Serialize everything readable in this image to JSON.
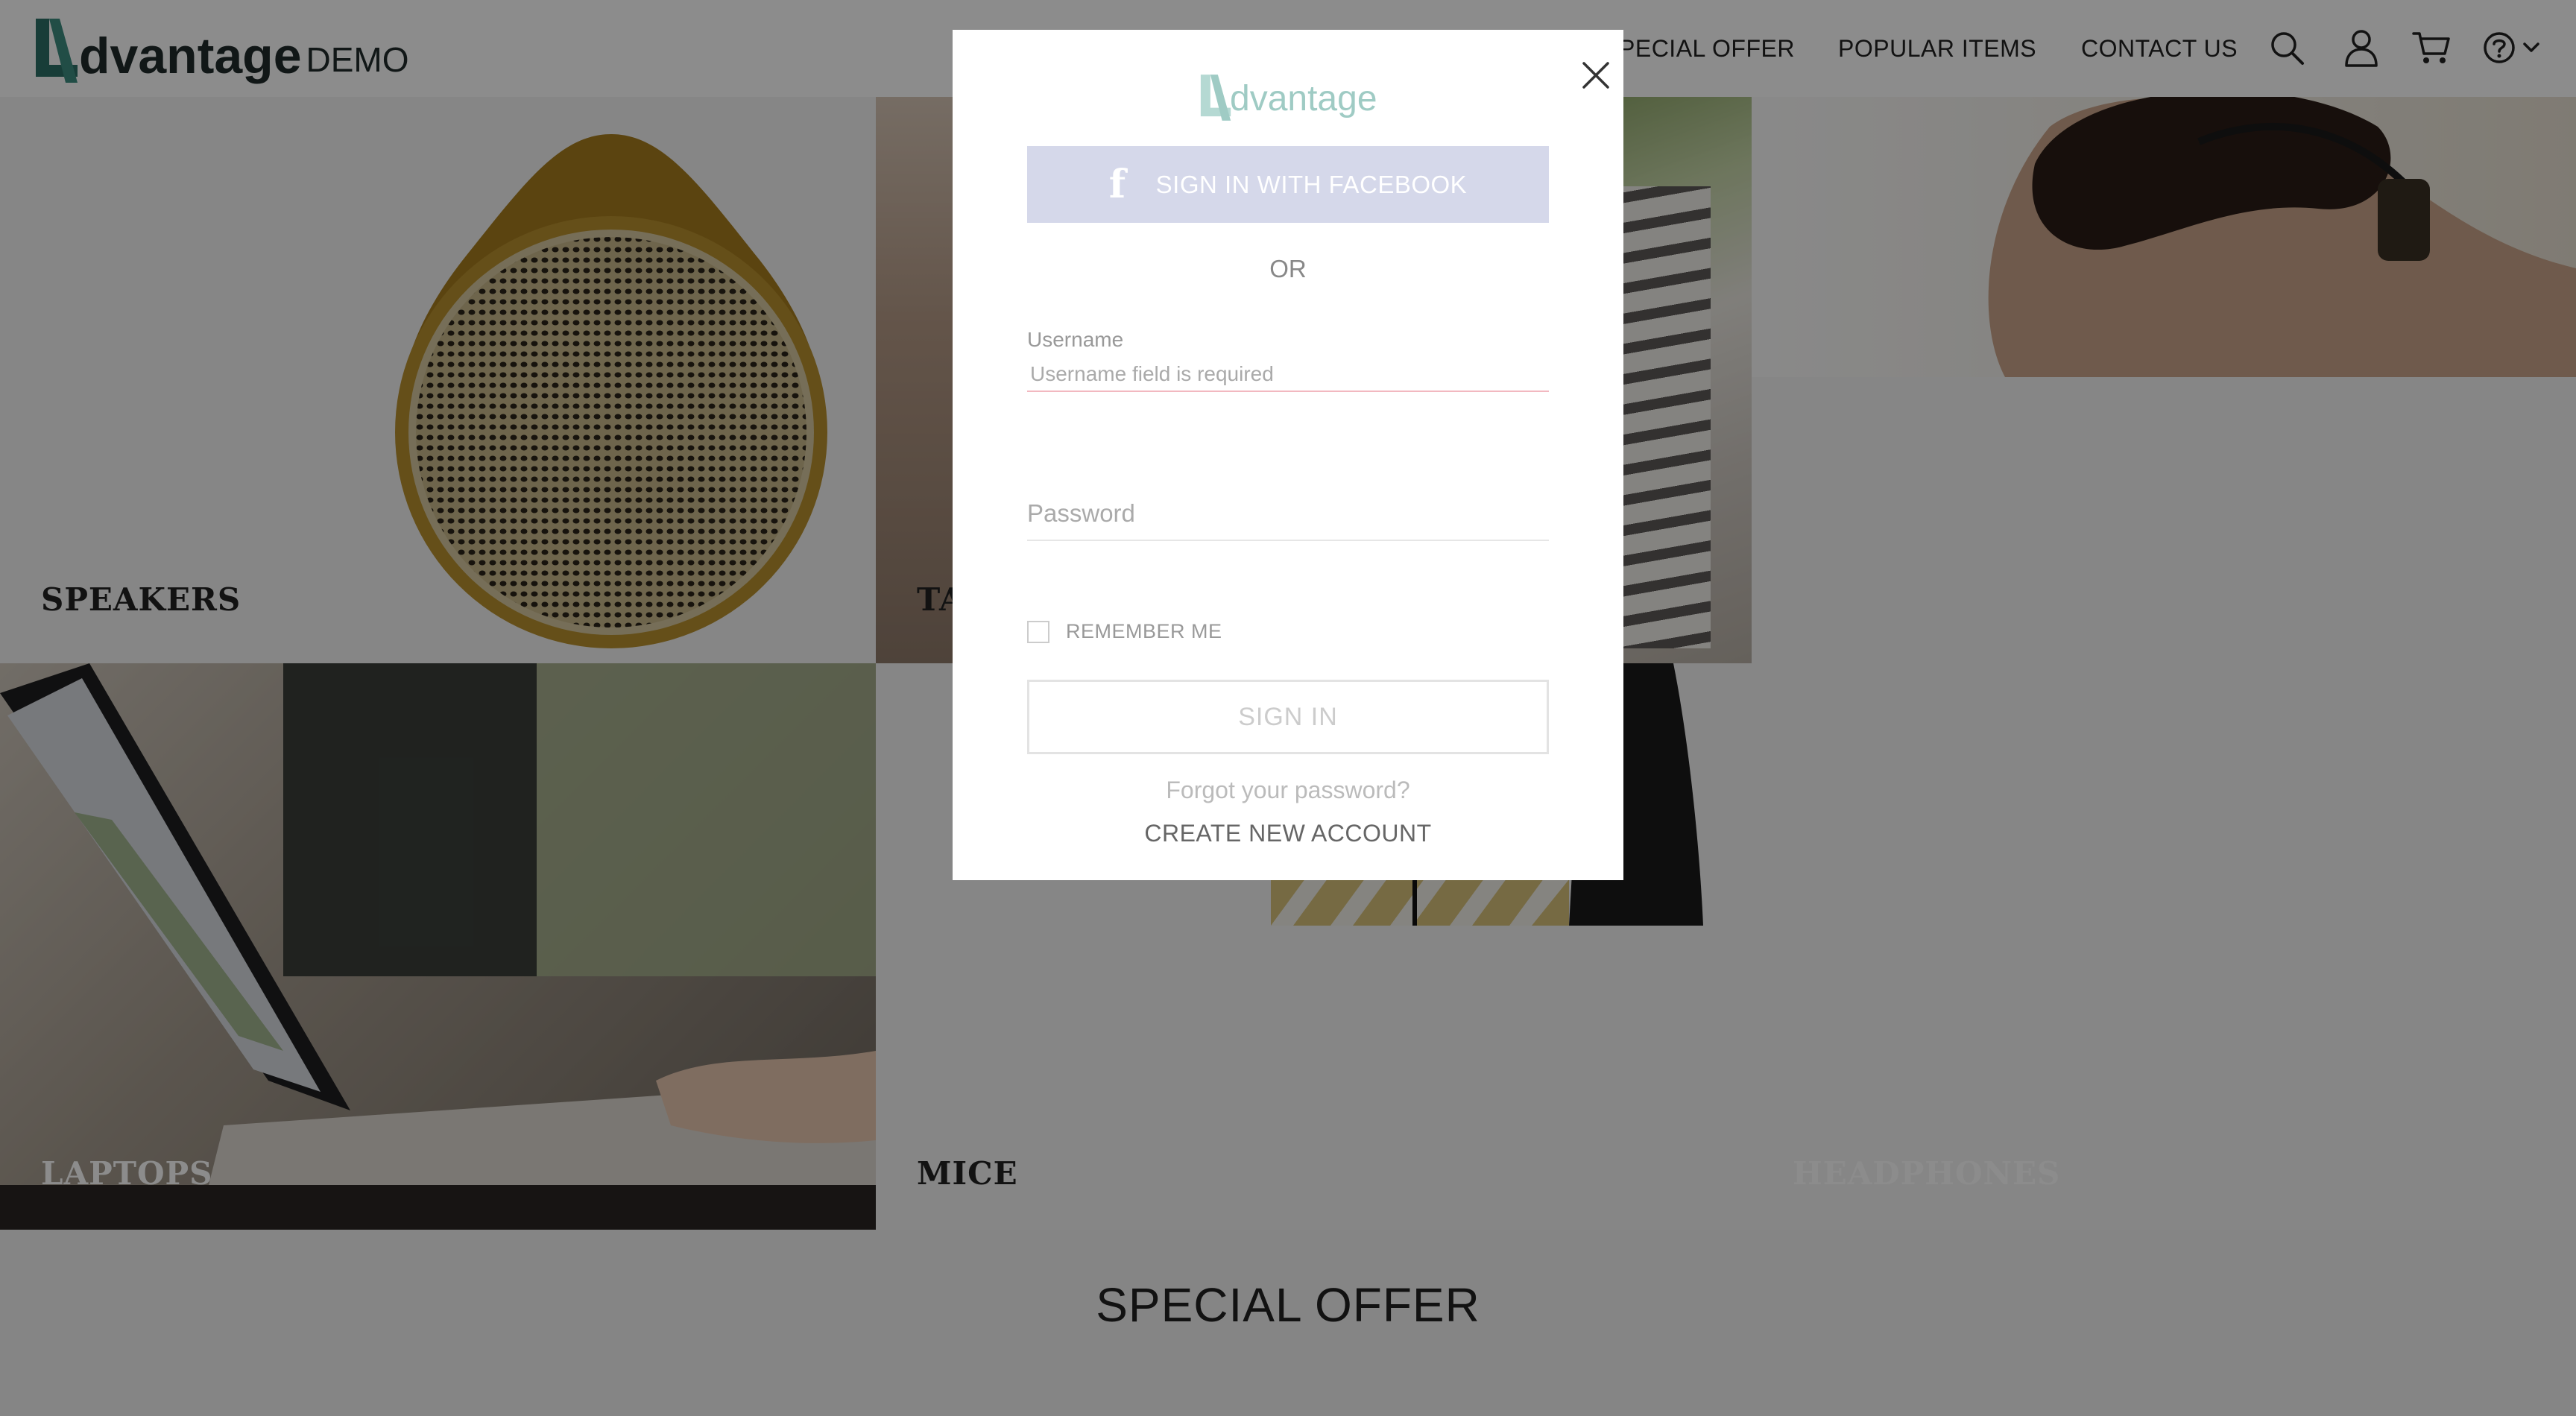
{
  "header": {
    "logo_word": "dvantage",
    "logo_suffix": "DEMO",
    "nav": {
      "special_offer": "PECIAL OFFER",
      "popular_items": "POPULAR ITEMS",
      "contact_us": "CONTACT US"
    },
    "icons": [
      "search-icon",
      "user-icon",
      "cart-icon",
      "help-icon",
      "chevron-down-icon"
    ]
  },
  "categories": {
    "speakers": "SPEAKERS",
    "tablets": "TA",
    "laptops": "LAPTOPS",
    "mice": "MICE",
    "headphones": "HEADPHONES"
  },
  "special_offer": {
    "title": "SPECIAL OFFER"
  },
  "login_modal": {
    "logo_word": "dvantage",
    "facebook_button": "SIGN IN WITH FACEBOOK",
    "or_text": "OR",
    "username_label": "Username",
    "username_error": "Username field is required",
    "password_placeholder": "Password",
    "remember_me": "REMEMBER ME",
    "sign_in_button": "SIGN IN",
    "forgot_password": "Forgot your password?",
    "create_account": "CREATE NEW ACCOUNT"
  },
  "colors": {
    "brand_teal": "#3d8c80",
    "facebook_button_bg": "#d5d8ea",
    "error_underline": "#f2b8c0",
    "overlay": "rgba(0,0,0,0.45)"
  }
}
